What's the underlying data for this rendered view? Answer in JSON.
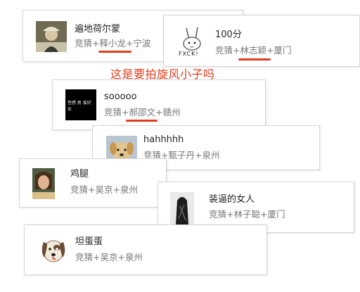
{
  "banner": {
    "text": "这是要拍旋风小子吗",
    "color": "#e23b1e"
  },
  "cards": [
    {
      "name": "遍地荷尔蒙",
      "tags": "竞猜+释小龙+宁波",
      "avatar": "man-in-hat-photo"
    },
    {
      "name": "100分",
      "tags": "竞猜+林志颖+厦门",
      "avatar": "rabbit-fxck-sketch",
      "avatar_text": "FXCK!"
    },
    {
      "name": "sooooo",
      "tags": "竞猜+郝邵文+赣州",
      "avatar": "black-text-image",
      "avatar_text": "性感 男 爱好 女"
    },
    {
      "name": "hahhhhh",
      "tags": "竞猜+甄子丹+泉州",
      "avatar": "puppy-photo"
    },
    {
      "name": "鸡腿",
      "tags": "竞猜+吴京+泉州",
      "avatar": "girl-photo"
    },
    {
      "name": "装逼的女人",
      "tags": "竞猜+林子聪+厦门",
      "avatar": "dark-figure-photo"
    },
    {
      "name": "坦蛋蛋",
      "tags": "竞猜+吴京+泉州",
      "avatar": "cartoon-dog"
    }
  ],
  "colors": {
    "highlight": "#e23b1e",
    "tag_text": "#777777",
    "name_text": "#222222",
    "border": "#d6d6d6"
  }
}
